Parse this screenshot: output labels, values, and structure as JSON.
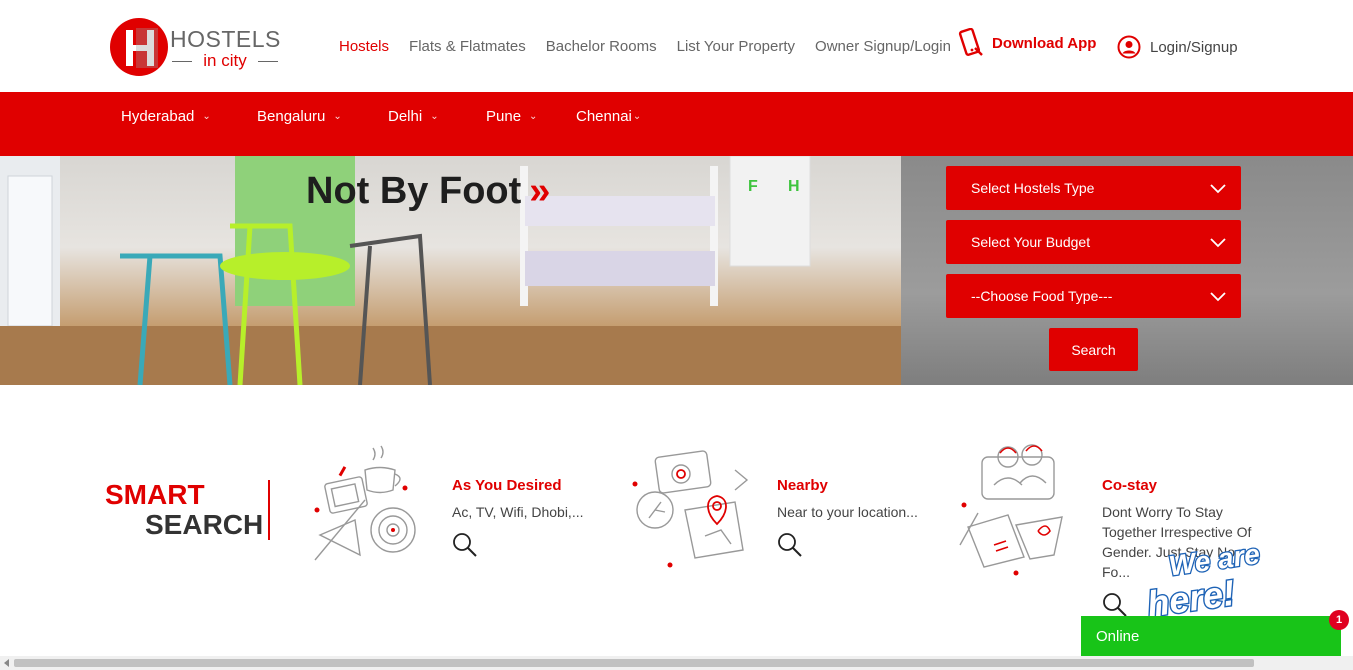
{
  "header": {
    "logo": {
      "text_top": "HOSTELS",
      "text_bottom": "in city"
    },
    "nav": [
      {
        "label": "Hostels",
        "active": true
      },
      {
        "label": "Flats & Flatmates",
        "active": false
      },
      {
        "label": "Bachelor Rooms",
        "active": false
      },
      {
        "label": "List Your Property",
        "active": false
      },
      {
        "label": "Owner Signup/Login",
        "active": false
      }
    ],
    "download_app": "Download App",
    "login": "Login/Signup"
  },
  "cities": [
    "Hyderabad",
    "Bengaluru",
    "Delhi",
    "Pune",
    "Chennai"
  ],
  "hero": {
    "title": "Not By Foot",
    "arrows": "»",
    "filters": {
      "hostel_type": "Select Hostels Type",
      "budget": "Select Your Budget",
      "food_type": "--Choose Food Type---"
    },
    "search_label": "Search"
  },
  "smart_search": {
    "line1": "SMART",
    "line2": "SEARCH",
    "features": [
      {
        "title": "As You Desired",
        "desc": "Ac, TV, Wifi, Dhobi,..."
      },
      {
        "title": "Nearby",
        "desc": "Near to your location..."
      },
      {
        "title": "Co-stay",
        "desc": "Dont Worry To Stay Together Irrespective Of Gender. Just Stay No Fo..."
      }
    ]
  },
  "chat": {
    "status": "Online",
    "badge": "1",
    "banner": "We are here!"
  },
  "colors": {
    "brand_red": "#e00000",
    "chat_green": "#18c418"
  }
}
